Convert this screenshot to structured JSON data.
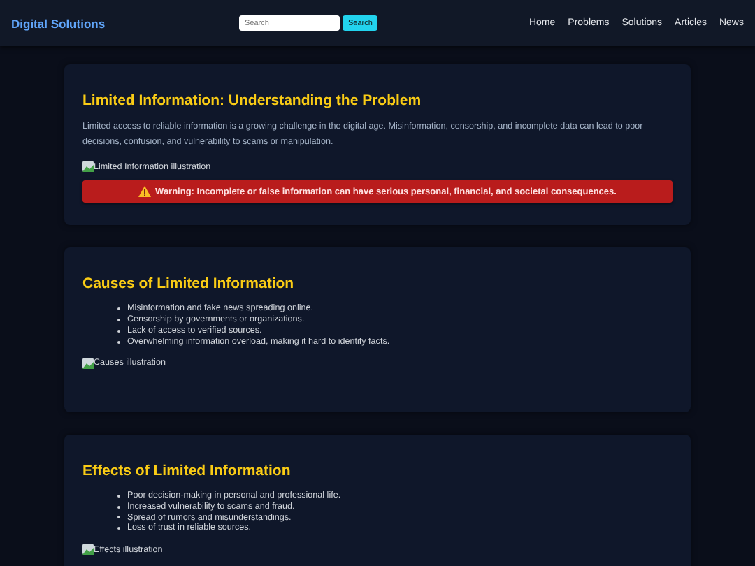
{
  "header": {
    "logo": "Digital Solutions",
    "search": {
      "placeholder": "Search",
      "button": "Search"
    },
    "nav": [
      "Home",
      "Problems",
      "Solutions",
      "Articles",
      "News"
    ]
  },
  "sections": [
    {
      "title": "Limited Information: Understanding the Problem",
      "paragraph": "Limited access to reliable information is a growing challenge in the digital age. Misinformation, censorship, and incomplete data can lead to poor decisions, confusion, and vulnerability to scams or manipulation.",
      "image_alt": "Limited Information illustration",
      "warning": "Warning: Incomplete or false information can have serious personal, financial, and societal consequences."
    },
    {
      "title": "Causes of Limited Information",
      "items": [
        "Misinformation and fake news spreading online.",
        "Censorship by governments or organizations.",
        "Lack of access to verified sources.",
        "Overwhelming information overload, making it hard to identify facts."
      ],
      "image_alt": "Causes illustration"
    },
    {
      "title": "Effects of Limited Information",
      "items": [
        "Poor decision-making in personal and professional life.",
        "Increased vulnerability to scams and fraud.",
        "Spread of rumors and misunderstandings.",
        "Loss of trust in reliable sources."
      ],
      "image_alt": "Effects illustration"
    }
  ]
}
